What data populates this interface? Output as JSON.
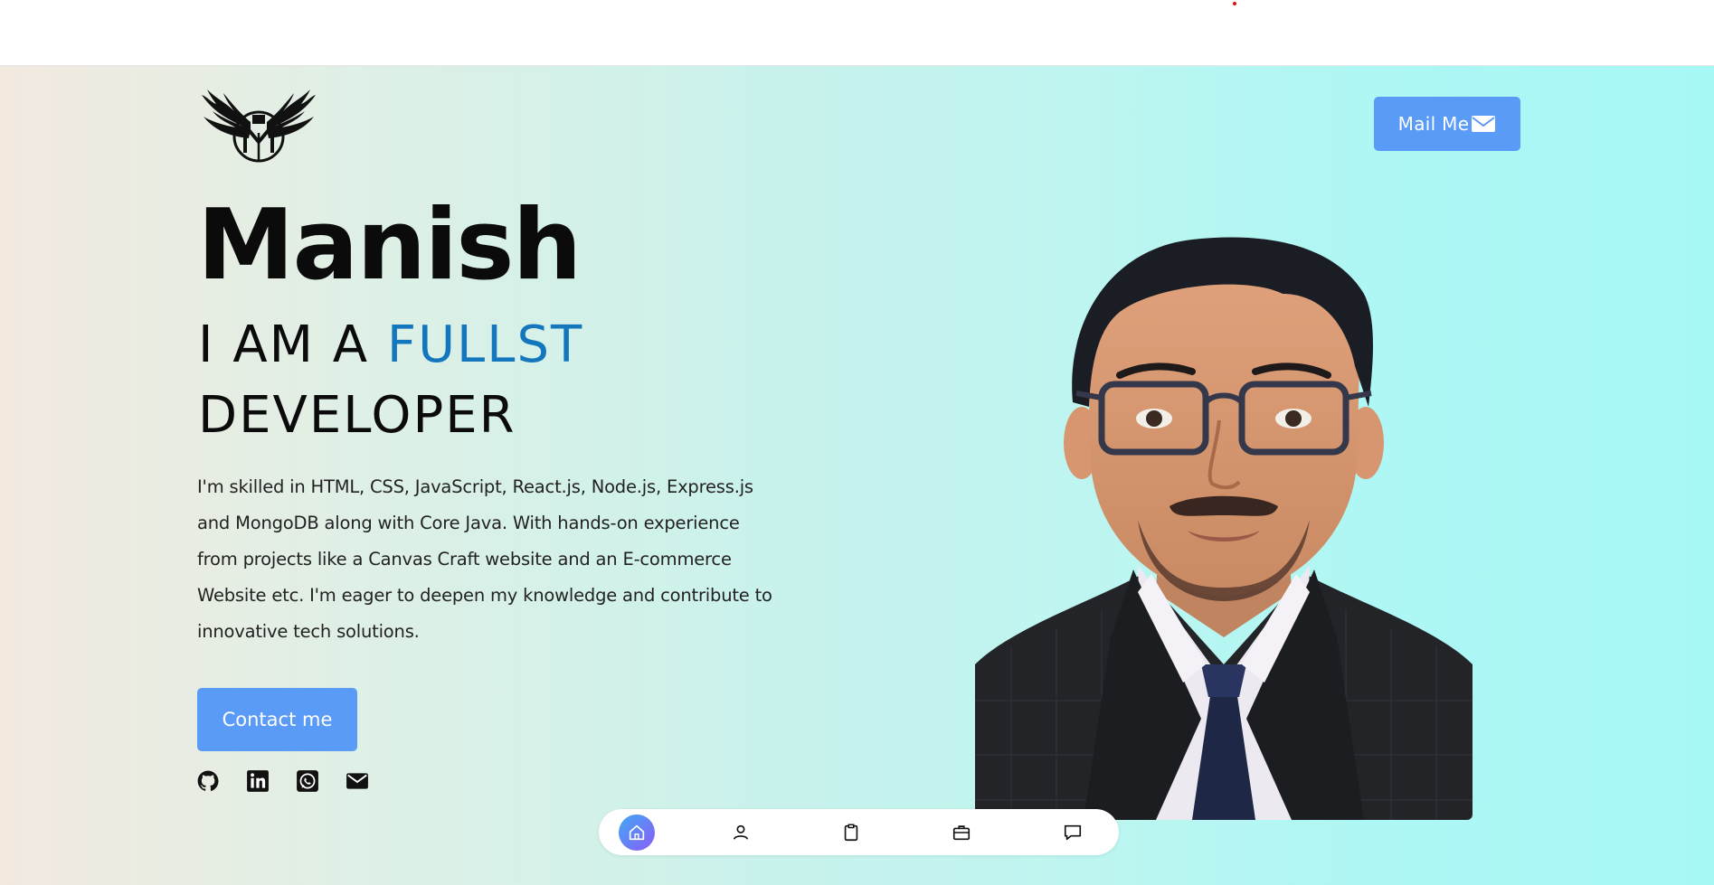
{
  "hero": {
    "name": "Manish",
    "role_prefix": "I AM A ",
    "role_typed": "FULLST",
    "role_suffix": "DEVELOPER",
    "bio": "I'm skilled in HTML, CSS, JavaScript, React.js, Node.js, Express.js and MongoDB along with Core Java. With hands-on experience from projects like a Canvas Craft website and an E-commerce Website etc. I'm eager to deepen my knowledge and contribute to innovative tech solutions.",
    "contact_label": "Contact me"
  },
  "header": {
    "logo_letter": "M",
    "mail_label": "Mail Me"
  },
  "socials": [
    "github-icon",
    "linkedin-icon",
    "whatsapp-icon",
    "email-icon"
  ],
  "dock": {
    "items": [
      "home-icon",
      "user-icon",
      "clipboard-icon",
      "briefcase-icon",
      "message-icon"
    ],
    "active": 0
  },
  "colors": {
    "accent": "#1477bd",
    "button": "#5b9bf8",
    "text": "#0b0b0b"
  }
}
